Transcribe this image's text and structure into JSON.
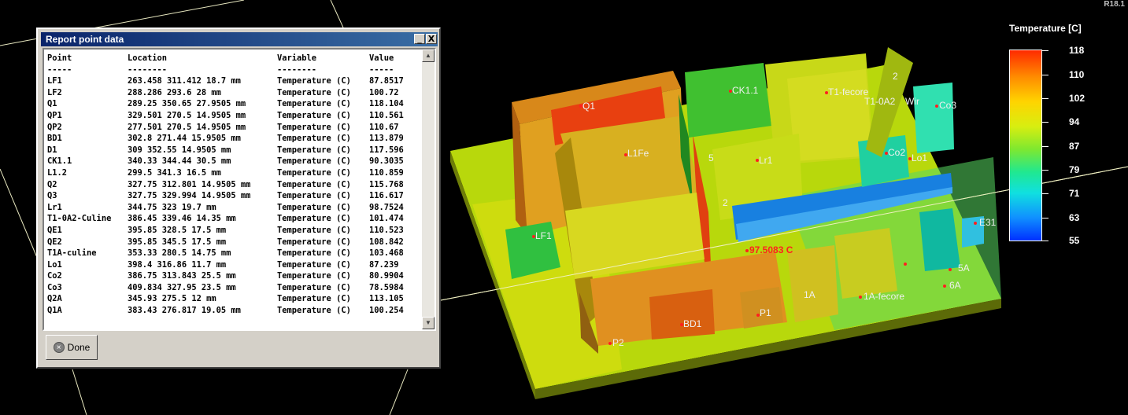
{
  "app": {
    "version_label": "R18.1"
  },
  "dialog": {
    "title": "Report point data",
    "minimize_glyph": "_",
    "close_glyph": "X",
    "done_label": "Done",
    "done_icon": "cancel-circle-icon",
    "columns": [
      "Point",
      "Location",
      "Variable",
      "Value"
    ],
    "separators": [
      "-----",
      "--------",
      "--------",
      "-----"
    ],
    "rows": [
      [
        "LF1",
        "263.458 311.412 18.7 mm",
        "Temperature (C)",
        "87.8517"
      ],
      [
        "LF2",
        "288.286 293.6 28 mm",
        "Temperature (C)",
        "100.72"
      ],
      [
        "Q1",
        "289.25 350.65 27.9505 mm",
        "Temperature (C)",
        "118.104"
      ],
      [
        "QP1",
        "329.501 270.5 14.9505 mm",
        "Temperature (C)",
        "110.561"
      ],
      [
        "QP2",
        "277.501 270.5 14.9505 mm",
        "Temperature (C)",
        "110.67"
      ],
      [
        "BD1",
        "302.8 271.44 15.9505 mm",
        "Temperature (C)",
        "113.879"
      ],
      [
        "D1",
        "309 352.55 14.9505 mm",
        "Temperature (C)",
        "117.596"
      ],
      [
        "CK1.1",
        "340.33 344.44 30.5 mm",
        "Temperature (C)",
        "90.3035"
      ],
      [
        "L1.2",
        "299.5 341.3 16.5 mm",
        "Temperature (C)",
        "110.859"
      ],
      [
        "Q2",
        "327.75 312.801 14.9505 mm",
        "Temperature (C)",
        "115.768"
      ],
      [
        "Q3",
        "327.75 329.994 14.9505 mm",
        "Temperature (C)",
        "116.617"
      ],
      [
        "Lr1",
        "344.75 323 19.7 mm",
        "Temperature (C)",
        "98.7524"
      ],
      [
        "T1-0A2-Culine",
        "386.45 339.46 14.35 mm",
        "Temperature (C)",
        "101.474"
      ],
      [
        "QE1",
        "395.85 328.5 17.5 mm",
        "Temperature (C)",
        "110.523"
      ],
      [
        "QE2",
        "395.85 345.5 17.5 mm",
        "Temperature (C)",
        "108.842"
      ],
      [
        "T1A-culine",
        "353.33 280.5 14.75 mm",
        "Temperature (C)",
        "103.468"
      ],
      [
        "Lo1",
        "398.4 316.86 11.7 mm",
        "Temperature (C)",
        "87.239"
      ],
      [
        "Co2",
        "386.75 313.843 25.5 mm",
        "Temperature (C)",
        "80.9904"
      ],
      [
        "Co3",
        "409.834 327.95 23.5 mm",
        "Temperature (C)",
        "78.5984"
      ],
      [
        "Q2A",
        "345.93 275.5 12 mm",
        "Temperature (C)",
        "113.105"
      ],
      [
        "Q1A",
        "383.43 276.817 19.05 mm",
        "Temperature (C)",
        "100.254"
      ]
    ]
  },
  "legend": {
    "title": "Temperature [C]",
    "ticks": [
      "118",
      "110",
      "102",
      "94",
      "87",
      "79",
      "71",
      "63",
      "55"
    ],
    "colors": [
      "#ff2a00",
      "#ff8c00",
      "#ffd400",
      "#d8ee10",
      "#7ee830",
      "#20e890",
      "#10e0e0",
      "#1090ff",
      "#0030ff"
    ]
  },
  "model_labels": {
    "q1": "Q1",
    "ck11": "CK1.1",
    "t1fecore": "T1-fecore",
    "t10a2": "T1-0A2",
    "wire": "Wir",
    "co3": "Co3",
    "l1fe": "L1Fe",
    "lr1": "Lr1",
    "co2": "Co2",
    "lo1": "Lo1",
    "lf1": "LF1",
    "probe": "97.5083 C",
    "qe31": "E31",
    "q5a": "5A",
    "q6a": "6A",
    "q1a": "1A",
    "t1afecore": "1A-fecore",
    "bd1": "BD1",
    "qp1": "P1",
    "qp2": "P2",
    "n2": "2",
    "n5": "5",
    "n2b": "2"
  }
}
